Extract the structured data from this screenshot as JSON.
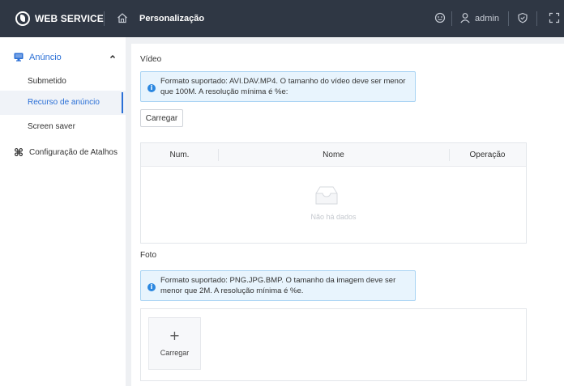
{
  "header": {
    "brand": "WEB SERVICE",
    "page_title": "Personalização",
    "user": "admin",
    "icons": [
      "logo-icon",
      "home-icon",
      "help-icon",
      "user-icon",
      "shield-icon",
      "fullscreen-icon"
    ]
  },
  "sidebar": {
    "group": {
      "label": "Anúncio",
      "icon": "monitor-icon",
      "expanded": true
    },
    "items": [
      {
        "label": "Submetido",
        "active": false
      },
      {
        "label": "Recurso de anúncio",
        "active": true
      },
      {
        "label": "Screen saver",
        "active": false
      }
    ],
    "shortcut": {
      "label": "Configuração de Atalhos",
      "icon": "command-icon"
    }
  },
  "video": {
    "title": "Vídeo",
    "info": "Formato suportado: AVI.DAV.MP4. O tamanho do vídeo deve ser menor que 100M. A resolução mínima é %e:",
    "upload_label": "Carregar",
    "table": {
      "columns": [
        "Num.",
        "Nome",
        "Operação"
      ],
      "rows": [],
      "empty_text": "Não há dados"
    }
  },
  "photo": {
    "title": "Foto",
    "info": "Formato suportado: PNG.JPG.BMP. O tamanho da imagem deve ser menor que 2M. A resolução mínima é %e.",
    "upload_plus": "+",
    "upload_label": "Carregar"
  },
  "colors": {
    "header_bg": "#2f3744",
    "accent": "#2a6fd6",
    "info_bg": "#e8f4fd",
    "info_border": "#a8d3f3"
  }
}
